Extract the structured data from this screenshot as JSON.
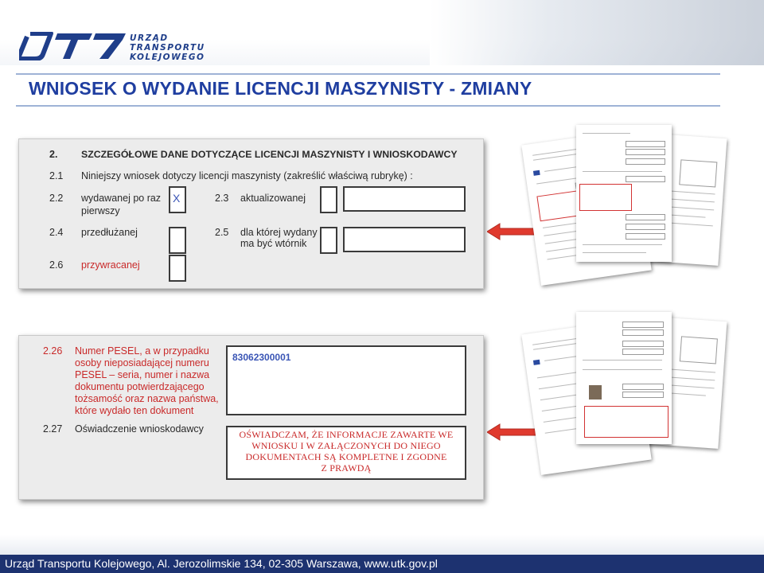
{
  "header": {
    "logo_lines": [
      "URZĄD",
      "TRANSPORTU",
      "KOLEJOWEGO"
    ]
  },
  "title": "WNIOSEK O WYDANIE LICENCJI MASZYNISTY - ZMIANY",
  "form1": {
    "section_no": "2.",
    "section_title": "SZCZEGÓŁOWE DANE DOTYCZĄCE LICENCJI MASZYNISTY I WNIOSKODAWCY",
    "row_2_1_no": "2.1",
    "row_2_1_text": "Niniejszy wniosek dotyczy licencji maszynisty (zakreślić właściwą rubrykę) :",
    "row_2_2_no": "2.2",
    "row_2_2_line1": "wydawanej po raz",
    "row_2_2_line2": "pierwszy",
    "row_2_2_mark": "X",
    "row_2_3_no": "2.3",
    "row_2_3_text": "aktualizowanej",
    "row_2_4_no": "2.4",
    "row_2_4_text": "przedłużanej",
    "row_2_5_no": "2.5",
    "row_2_5_line1": "dla której wydany",
    "row_2_5_line2": "ma być wtórnik",
    "row_2_6_no": "2.6",
    "row_2_6_text": "przywracanej"
  },
  "form2": {
    "row_2_26_no": "2.26",
    "row_2_26_lines": [
      "Numer PESEL, a w przypadku",
      "osoby nieposiadającej numeru",
      "PESEL – seria, numer i nazwa",
      "dokumentu potwierdzającego",
      "tożsamość oraz nazwa państwa,",
      "które wydało ten dokument"
    ],
    "pesel_value": "83062300001",
    "row_2_27_no": "2.27",
    "row_2_27_text": "Oświadczenie wnioskodawcy",
    "declaration_lines": [
      "OŚWIADCZAM, ŻE INFORMACJE ZAWARTE WE",
      "WNIOSKU I W ZAŁĄCZONYCH DO NIEGO",
      "DOKUMENTACH SĄ KOMPLETNE I ZGODNE",
      "Z PRAWDĄ"
    ]
  },
  "footer": {
    "text": "Urząd Transportu Kolejowego, Al. Jerozolimskie 134, 02-305 Warszawa, www.utk.gov.pl"
  },
  "colors": {
    "title": "#1f3ea0",
    "footer_bg": "#1d3270",
    "accent_red": "#c92a2a",
    "arrow_red": "#e03a2e"
  }
}
